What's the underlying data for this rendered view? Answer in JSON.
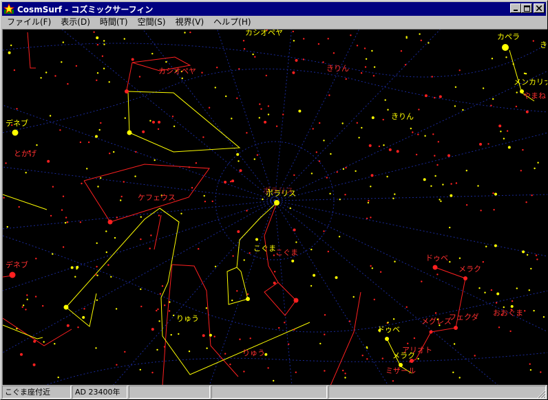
{
  "window": {
    "title": "CosmSurf - コズミックサーフィン",
    "buttons": {
      "minimize": "_",
      "maximize": "□",
      "close": "×"
    }
  },
  "menu": [
    "ファイル(F)",
    "表示(D)",
    "時間(T)",
    "空間(S)",
    "視界(V)",
    "ヘルプ(H)"
  ],
  "sky": {
    "labels": [
      {
        "text": "カシオペヤ",
        "color": "#ffff00"
      },
      {
        "text": "カシオペヤ",
        "color": "#ff3030"
      },
      {
        "text": "きりん",
        "color": "#ff3030"
      },
      {
        "text": "きりん",
        "color": "#ffff00"
      },
      {
        "text": "カペラ",
        "color": "#ffff00"
      },
      {
        "text": "き",
        "color": "#ffff00"
      },
      {
        "text": "メンカリナン",
        "color": "#ffff00"
      },
      {
        "text": "やまね",
        "color": "#ff3030"
      },
      {
        "text": "デネブ",
        "color": "#ffff00"
      },
      {
        "text": "とかげ",
        "color": "#ff3030"
      },
      {
        "text": "ケフェウス",
        "color": "#ff3030"
      },
      {
        "text": "ポラリス",
        "color": "#ffff00"
      },
      {
        "text": "ポラリス",
        "color": "#ff3030"
      },
      {
        "text": "こぐま",
        "color": "#ffff00"
      },
      {
        "text": "こぐま",
        "color": "#ff3030"
      },
      {
        "text": "デネブ",
        "color": "#ff3030"
      },
      {
        "text": "ドゥベ",
        "color": "#ff3030"
      },
      {
        "text": "メラク",
        "color": "#ff3030"
      },
      {
        "text": "りゅう",
        "color": "#ffff00"
      },
      {
        "text": "りゅう",
        "color": "#ff3030"
      },
      {
        "text": "メグレズ",
        "color": "#ff3030"
      },
      {
        "text": "フェクダ",
        "color": "#ff3030"
      },
      {
        "text": "おおぐま",
        "color": "#ff3030"
      },
      {
        "text": "ドゥベ",
        "color": "#ffff00"
      },
      {
        "text": "メラク",
        "color": "#ffff00"
      },
      {
        "text": "アリオト",
        "color": "#ff3030"
      },
      {
        "text": "ミザール",
        "color": "#ff3030"
      }
    ]
  },
  "status": {
    "location": "こぐま座付近",
    "date": "AD 23400年",
    "pane3": "",
    "pane4": "",
    "pane5": ""
  },
  "colors": {
    "title_bg": "#000080",
    "sky_bg": "#000000",
    "yellow": "#ffff00",
    "red": "#ff2020",
    "grid": "#1a2a9a"
  }
}
